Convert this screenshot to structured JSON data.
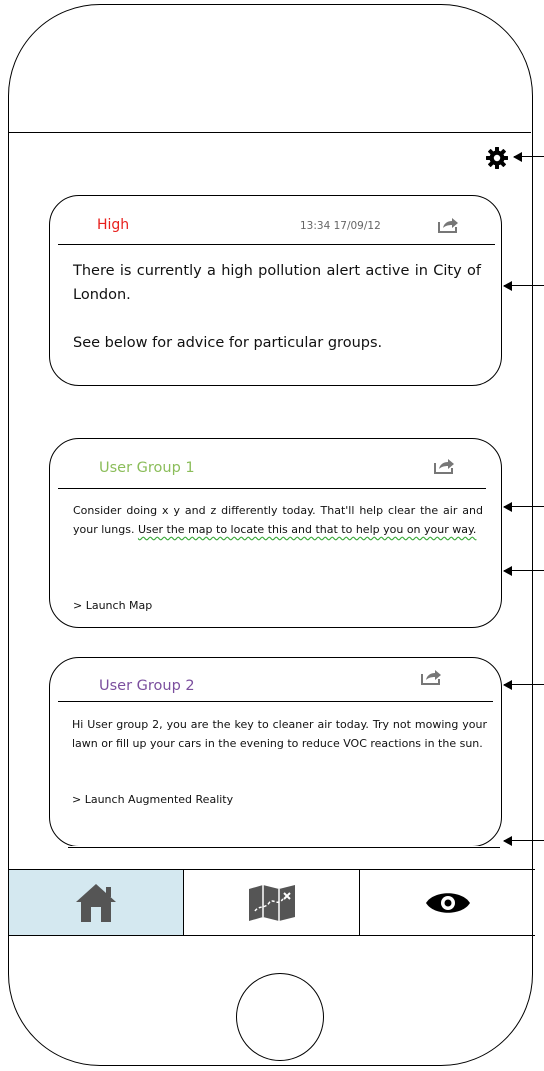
{
  "toolbar": {
    "settings_icon": "gear-icon"
  },
  "alert_card": {
    "level": "High",
    "level_color": "#e8201d",
    "timestamp": "13:34 17/09/12",
    "message": "There is currently a high pollution alert active in City of London.",
    "advice": "See below for advice for particular groups.",
    "share_icon": "share-icon"
  },
  "group_cards": [
    {
      "title": "User Group 1",
      "title_color": "#8bbd5a",
      "body_plain": "Consider doing x y and z differently today. That'll help clear the air and your lungs.",
      "body_flagged": "User the map to locate this and that to help you on your way.",
      "link": "> Launch Map",
      "share_icon": "share-icon"
    },
    {
      "title": "User Group 2",
      "title_color": "#7b4f9e",
      "body": "Hi User group 2, you are the key to cleaner air today. Try not mowing your lawn or fill up your cars in the evening to reduce VOC reactions in the sun.",
      "link": "> Launch Augmented Reality",
      "share_icon": "share-icon"
    }
  ],
  "nav": {
    "items": [
      {
        "icon": "home-icon",
        "active": true
      },
      {
        "icon": "map-icon",
        "active": false
      },
      {
        "icon": "eye-icon",
        "active": false
      }
    ],
    "active_color": "#d4e8f0"
  }
}
